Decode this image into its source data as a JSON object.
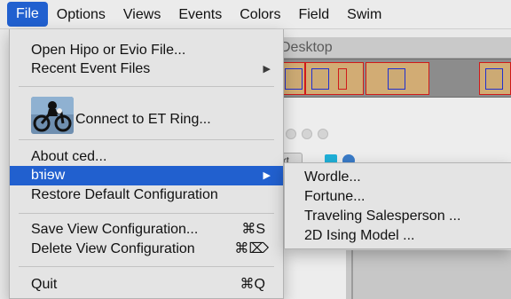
{
  "menubar": {
    "items": [
      {
        "label": "File",
        "active": true
      },
      {
        "label": "Options",
        "active": false
      },
      {
        "label": "Views",
        "active": false
      },
      {
        "label": "Events",
        "active": false
      },
      {
        "label": "Colors",
        "active": false
      },
      {
        "label": "Field",
        "active": false
      },
      {
        "label": "Swim",
        "active": false
      }
    ]
  },
  "background": {
    "desktop_title": "Desktop",
    "next_button": "Next",
    "toolbar_small_button": "ext"
  },
  "file_menu": {
    "open_file": "Open Hipo or Evio File...",
    "recent_files": "Recent Event Files",
    "connect_et": "Connect to ET Ring...",
    "about": "About ced...",
    "weird": "weird",
    "restore_default": "Restore Default Configuration",
    "save_view": "Save View Configuration...",
    "save_view_shortcut": "⌘S",
    "delete_view": "Delete View Configuration",
    "delete_view_shortcut": "⌘⌦",
    "quit": "Quit",
    "quit_shortcut": "⌘Q",
    "submenu_arrow_icon": "triangle-right-icon",
    "et_ring_icon": "bike-flying-icon"
  },
  "weird_submenu": {
    "items": [
      "Wordle...",
      "Fortune...",
      "Traveling Salesperson ...",
      "2D Ising Model ..."
    ]
  },
  "colors": {
    "menu_highlight": "#2160cf",
    "menu_background": "#e4e4e4",
    "tile_fill": "#d2ac74",
    "tile_border": "#d01a1a",
    "tile_inner_border": "#2030d0"
  }
}
